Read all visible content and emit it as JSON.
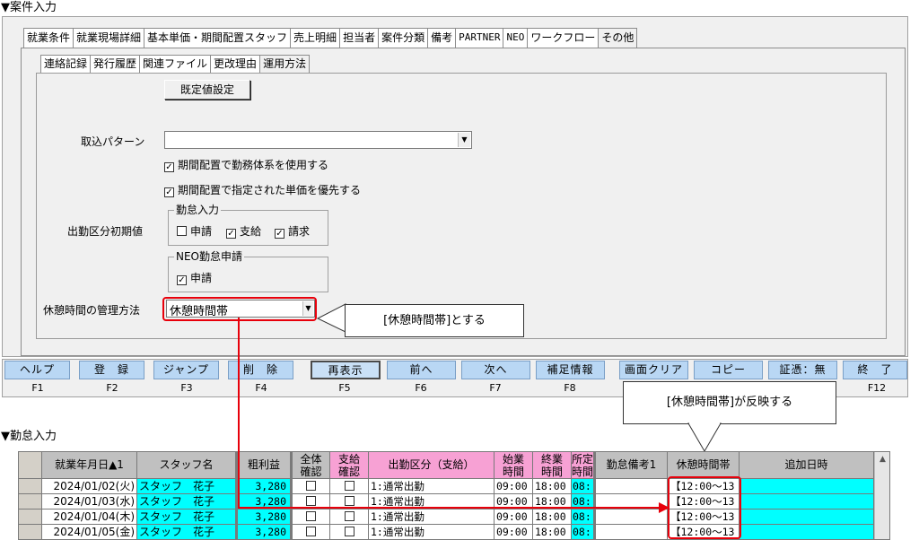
{
  "sections": {
    "case_input_title": "▼案件入力",
    "attendance_title": "▼勤怠入力"
  },
  "tabs": [
    {
      "label": "就業条件",
      "active": false
    },
    {
      "label": "就業現場詳細",
      "active": false
    },
    {
      "label": "基本単価・期間配置スタッフ",
      "active": false
    },
    {
      "label": "売上明細",
      "active": false
    },
    {
      "label": "担当者",
      "active": false
    },
    {
      "label": "案件分類",
      "active": false
    },
    {
      "label": "備考",
      "active": false
    },
    {
      "label": "PARTNER",
      "active": false
    },
    {
      "label": "NEO",
      "active": false
    },
    {
      "label": "ワークフロー",
      "active": false
    },
    {
      "label": "その他",
      "active": true
    }
  ],
  "subtabs": [
    {
      "label": "連絡記録",
      "active": false
    },
    {
      "label": "発行履歴",
      "active": false
    },
    {
      "label": "関連ファイル",
      "active": false
    },
    {
      "label": "更改理由",
      "active": false
    },
    {
      "label": "運用方法",
      "active": true
    }
  ],
  "form": {
    "default_button": "既定値設定",
    "import_pattern_label": "取込パターン",
    "import_pattern_value": "",
    "check_use_work_system": "期間配置で勤務体系を使用する",
    "check_use_work_system_checked": true,
    "check_prioritize_price": "期間配置で指定された単価を優先する",
    "check_prioritize_price_checked": true,
    "attendance_default_label": "出勤区分初期値",
    "attendance_group_legend": "勤怠入力",
    "attendance_options": [
      {
        "label": "申請",
        "checked": false
      },
      {
        "label": "支給",
        "checked": true
      },
      {
        "label": "請求",
        "checked": true
      }
    ],
    "neo_group_legend": "NEO勤怠申請",
    "neo_options": [
      {
        "label": "申請",
        "checked": true
      }
    ],
    "break_mgmt_label": "休憩時間の管理方法",
    "break_mgmt_value": "休憩時間帯"
  },
  "callouts": {
    "set_break": "[休憩時間帯]とする",
    "reflected": "[休憩時間帯]が反映する"
  },
  "fkeys": [
    {
      "label": "ヘルプ",
      "key": "F1"
    },
    {
      "label": "登　録",
      "key": "F2"
    },
    {
      "label": "ジャンプ",
      "key": "F3"
    },
    {
      "label": "削　除",
      "key": "F4"
    },
    {
      "label": "再表示",
      "key": "F5"
    },
    {
      "label": "前へ",
      "key": "F6"
    },
    {
      "label": "次へ",
      "key": "F7"
    },
    {
      "label": "補足情報",
      "key": "F8"
    },
    {
      "label": "画面クリア",
      "key": ""
    },
    {
      "label": "コピー",
      "key": ""
    },
    {
      "label": "証憑：無",
      "key": ""
    },
    {
      "label": "終　了",
      "key": "F12"
    }
  ],
  "grid": {
    "headers": {
      "date": "就業年月日▲1",
      "staff": "スタッフ名",
      "gross": "粗利益",
      "all_confirm": "全体\n確認",
      "pay_confirm": "支給\n確認",
      "attendance_type": "出勤区分（支給）",
      "start": "始業\n時間",
      "end": "終業\n時間",
      "req": "所定\n時間",
      "note": "勤怠備考1",
      "break": "休憩時間帯",
      "added": "追加日時"
    },
    "rows": [
      {
        "date": "2024/01/02(火)",
        "staff": "スタッフ　花子",
        "gross": "3,280",
        "type": "1:通常出勤",
        "start": "09:00",
        "end": "18:00",
        "req": "08:",
        "break": "【12:00～13"
      },
      {
        "date": "2024/01/03(水)",
        "staff": "スタッフ　花子",
        "gross": "3,280",
        "type": "1:通常出勤",
        "start": "09:00",
        "end": "18:00",
        "req": "08:",
        "break": "【12:00～13"
      },
      {
        "date": "2024/01/04(木)",
        "staff": "スタッフ　花子",
        "gross": "3,280",
        "type": "1:通常出勤",
        "start": "09:00",
        "end": "18:00",
        "req": "08:",
        "break": "【12:00～13"
      },
      {
        "date": "2024/01/05(金)",
        "staff": "スタッフ　花子",
        "gross": "3,280",
        "type": "1:通常出勤",
        "start": "09:00",
        "end": "18:00",
        "req": "08:",
        "break": "【12:00～13"
      }
    ]
  },
  "colors": {
    "accent_red": "#e8000b",
    "cyan": "#00ffff",
    "pink_header": "#f7a1d4",
    "fkey_blue": "#b9d7f4"
  }
}
